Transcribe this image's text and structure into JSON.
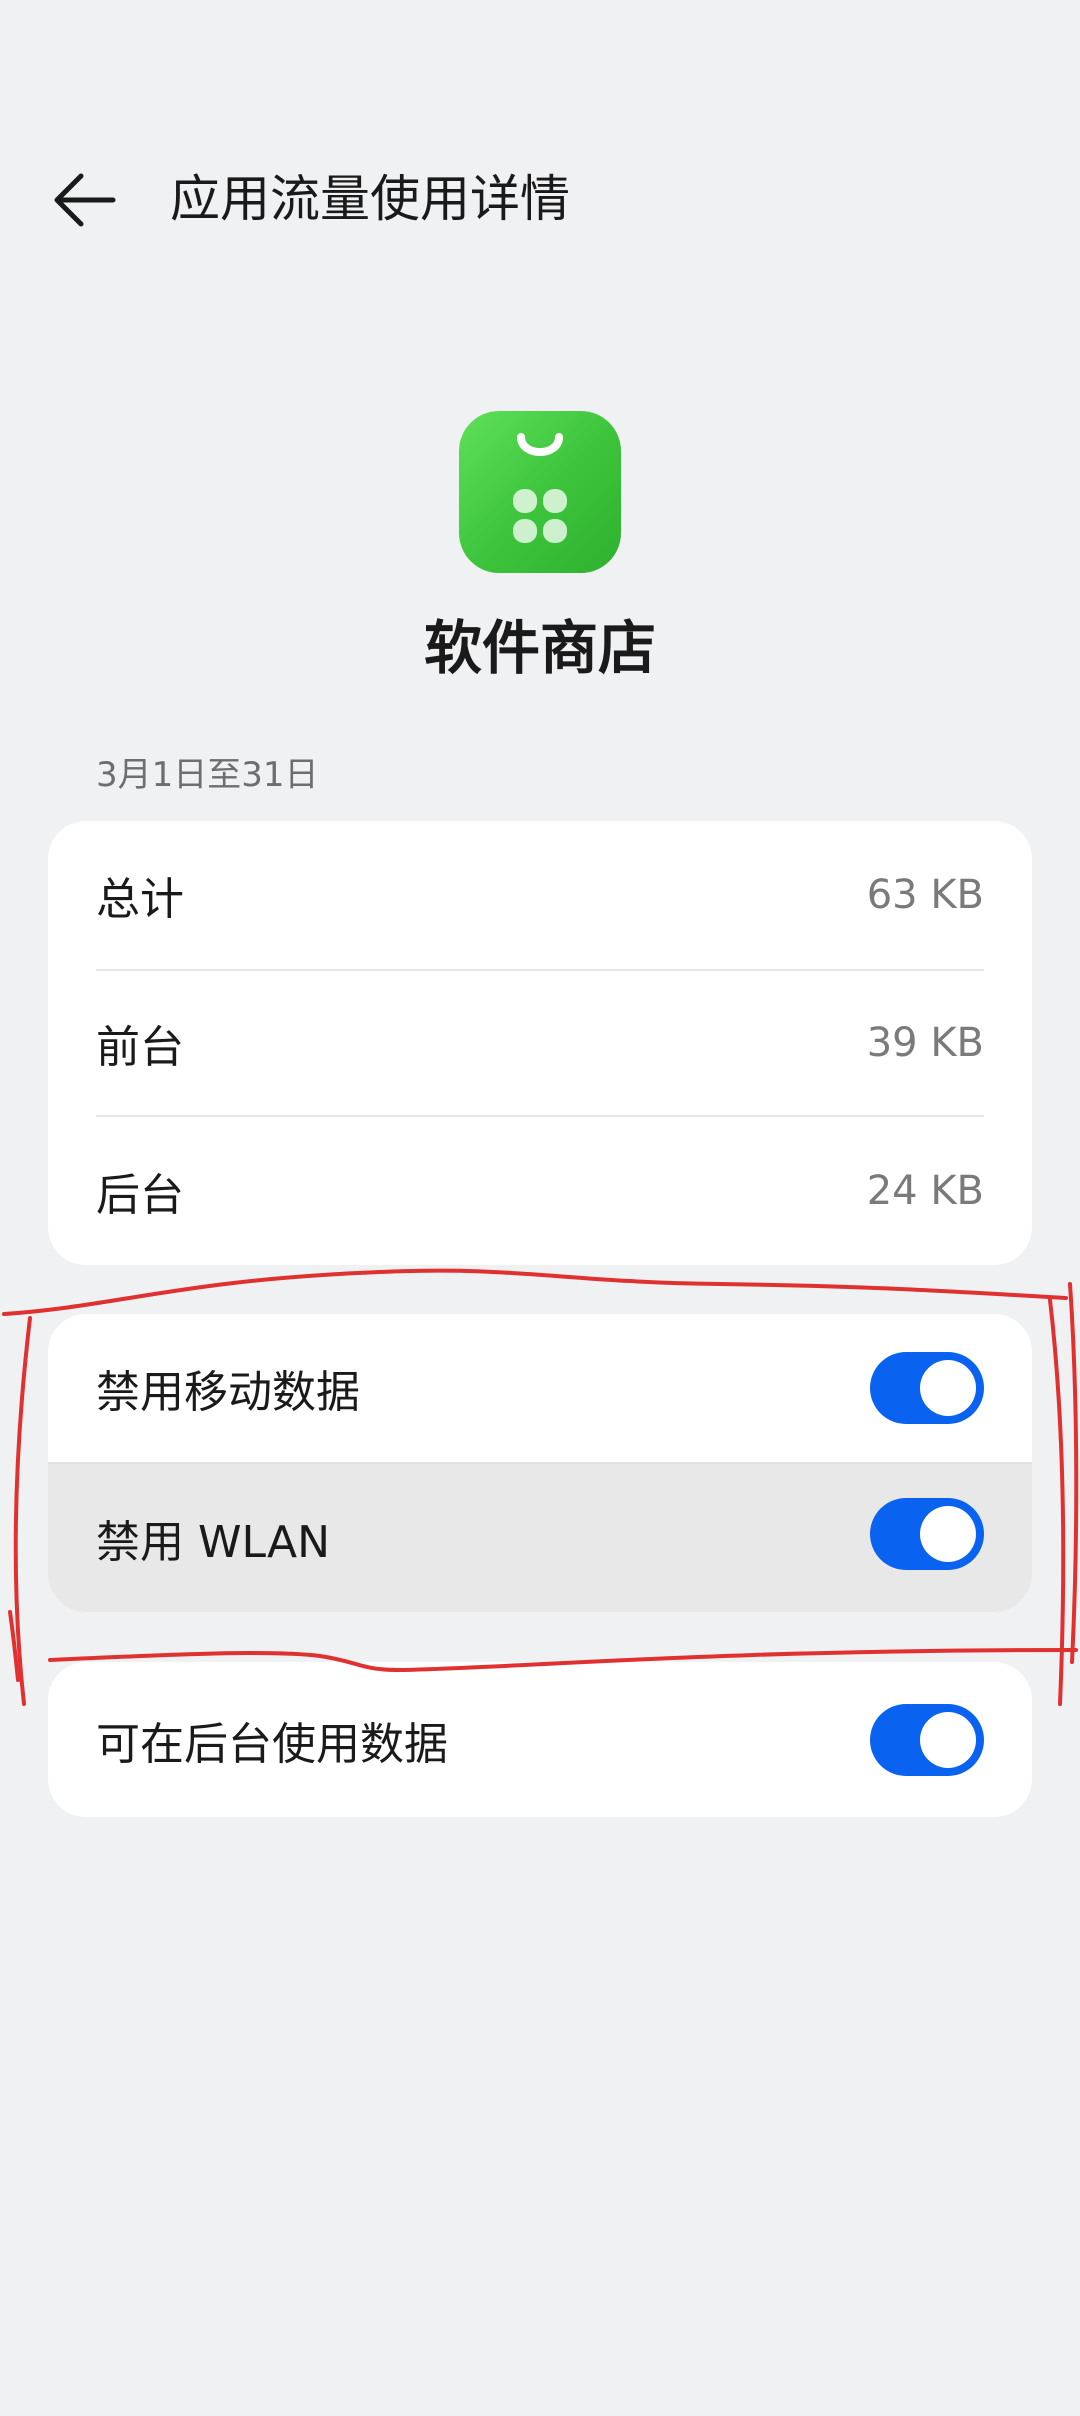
{
  "header": {
    "title": "应用流量使用详情"
  },
  "app": {
    "name": "软件商店",
    "icon": "app-store-icon",
    "icon_color": "#3cc33b"
  },
  "period": {
    "label": "3月1日至31日"
  },
  "usage": {
    "rows": [
      {
        "label": "总计",
        "value": "63 KB"
      },
      {
        "label": "前台",
        "value": "39 KB"
      },
      {
        "label": "后台",
        "value": "24 KB"
      }
    ]
  },
  "network": {
    "rows": [
      {
        "label": "禁用移动数据",
        "enabled": true
      },
      {
        "label": "禁用 WLAN",
        "enabled": true
      }
    ]
  },
  "background": {
    "rows": [
      {
        "label": "可在后台使用数据",
        "enabled": true
      }
    ]
  },
  "colors": {
    "accent": "#0a62f0",
    "annotation": "#e03030",
    "background": "#f0f1f3"
  }
}
